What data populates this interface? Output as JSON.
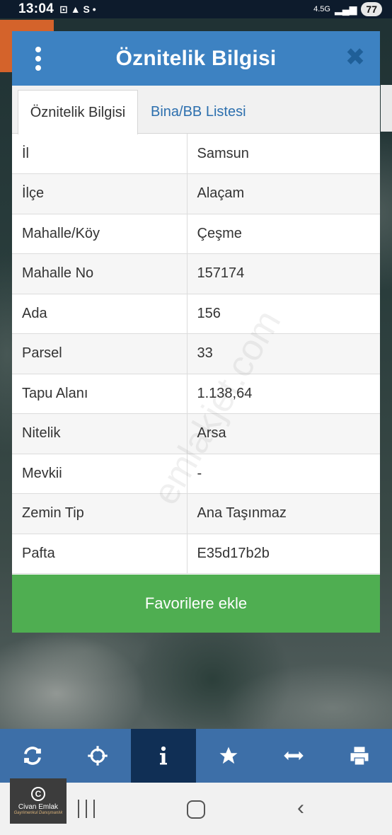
{
  "status_bar": {
    "time": "13:04",
    "left_icons": "⊡ ▲ S •",
    "network": "4.5G",
    "battery": "77"
  },
  "dialog": {
    "title": "Öznitelik Bilgisi",
    "tabs": [
      {
        "label": "Öznitelik Bilgisi",
        "active": true
      },
      {
        "label": "Bina/BB Listesi",
        "active": false
      }
    ],
    "rows": [
      {
        "key": "İl",
        "value": "Samsun"
      },
      {
        "key": "İlçe",
        "value": "Alaçam"
      },
      {
        "key": "Mahalle/Köy",
        "value": "Çeşme"
      },
      {
        "key": "Mahalle No",
        "value": "157174"
      },
      {
        "key": "Ada",
        "value": "156"
      },
      {
        "key": "Parsel",
        "value": "33"
      },
      {
        "key": "Tapu Alanı",
        "value": "1.138,64"
      },
      {
        "key": "Nitelik",
        "value": "Arsa"
      },
      {
        "key": "Mevkii",
        "value": "-"
      },
      {
        "key": "Zemin Tip",
        "value": "Ana Taşınmaz"
      },
      {
        "key": "Pafta",
        "value": "E35d17b2b"
      }
    ],
    "favorite_button": "Favorilere ekle"
  },
  "watermark": "emlakjet.com",
  "toolbar": {
    "items": [
      {
        "icon": "refresh-icon",
        "active": false
      },
      {
        "icon": "crosshair-icon",
        "active": false
      },
      {
        "icon": "info-icon",
        "active": true
      },
      {
        "icon": "star-icon",
        "active": false
      },
      {
        "icon": "measure-icon",
        "active": false
      },
      {
        "icon": "print-icon",
        "active": false
      }
    ]
  },
  "logo": {
    "name": "Civan Emlak",
    "tagline": "Gayrimenkul Danışmanlık"
  },
  "colors": {
    "header": "#3d82c2",
    "favorite": "#4fae51",
    "toolbar": "#3d6fa8",
    "toolbar_active": "#102f55"
  }
}
